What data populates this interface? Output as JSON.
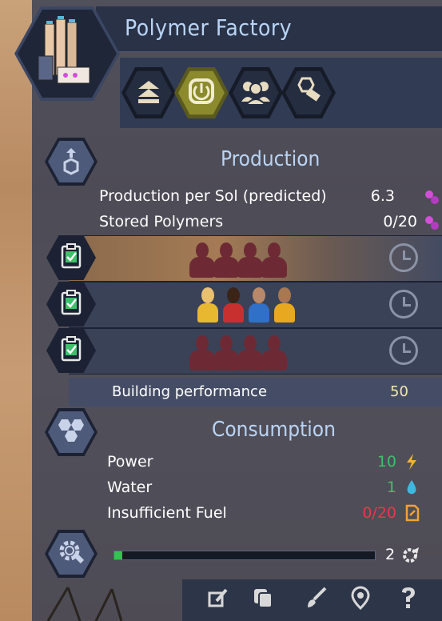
{
  "building": {
    "title": "Polymer Factory",
    "icon": "polymer-factory-building-icon"
  },
  "tabs": [
    {
      "name": "upgrade-tab",
      "icon": "chevrons-up-icon",
      "active": false
    },
    {
      "name": "power-tab",
      "icon": "power-icon",
      "active": true
    },
    {
      "name": "workers-tab",
      "icon": "workers-icon",
      "active": false
    },
    {
      "name": "maintenance-tab",
      "icon": "gear-bolt-icon",
      "active": false
    }
  ],
  "production": {
    "title": "Production",
    "rows": [
      {
        "label": "Production per Sol (predicted)",
        "value": "6.3",
        "icon": "polymer-icon"
      },
      {
        "label": "Stored Polymers",
        "value": "0/20",
        "icon": "polymer-icon"
      }
    ]
  },
  "shifts": [
    {
      "state": "empty",
      "icon": "clipboard-check-icon",
      "clock_icon": "clock-icon"
    },
    {
      "state": "staffed",
      "icon": "clipboard-check-icon",
      "clock_icon": "clock-icon"
    },
    {
      "state": "empty",
      "icon": "clipboard-check-icon",
      "clock_icon": "clock-icon"
    }
  ],
  "performance": {
    "label": "Building performance",
    "value": "50"
  },
  "consumption": {
    "title": "Consumption",
    "rows": [
      {
        "label": "Power",
        "value": "10",
        "icon": "lightning-icon",
        "color": "#3fc06a"
      },
      {
        "label": "Water",
        "value": "1",
        "icon": "water-drop-icon",
        "color": "#3fc06a"
      },
      {
        "label": "Insufficient Fuel",
        "value": "0/20",
        "icon": "fuel-canister-icon",
        "color": "#e8384a"
      }
    ]
  },
  "maintenance": {
    "progress": 0.03,
    "value": "2",
    "icon": "gear-wrench-icon"
  },
  "bottom_actions": [
    {
      "name": "rename-button",
      "icon": "edit-icon"
    },
    {
      "name": "copy-button",
      "icon": "copy-icon"
    },
    {
      "name": "paint-button",
      "icon": "brush-icon"
    },
    {
      "name": "locate-button",
      "icon": "location-pin-icon"
    },
    {
      "name": "help-button",
      "icon": "question-icon"
    }
  ],
  "colors": {
    "title": "#b9d4f5",
    "performance_value": "#f2e6b0",
    "polymer": "#d24fd8",
    "checkbox": "#3fc06a"
  }
}
